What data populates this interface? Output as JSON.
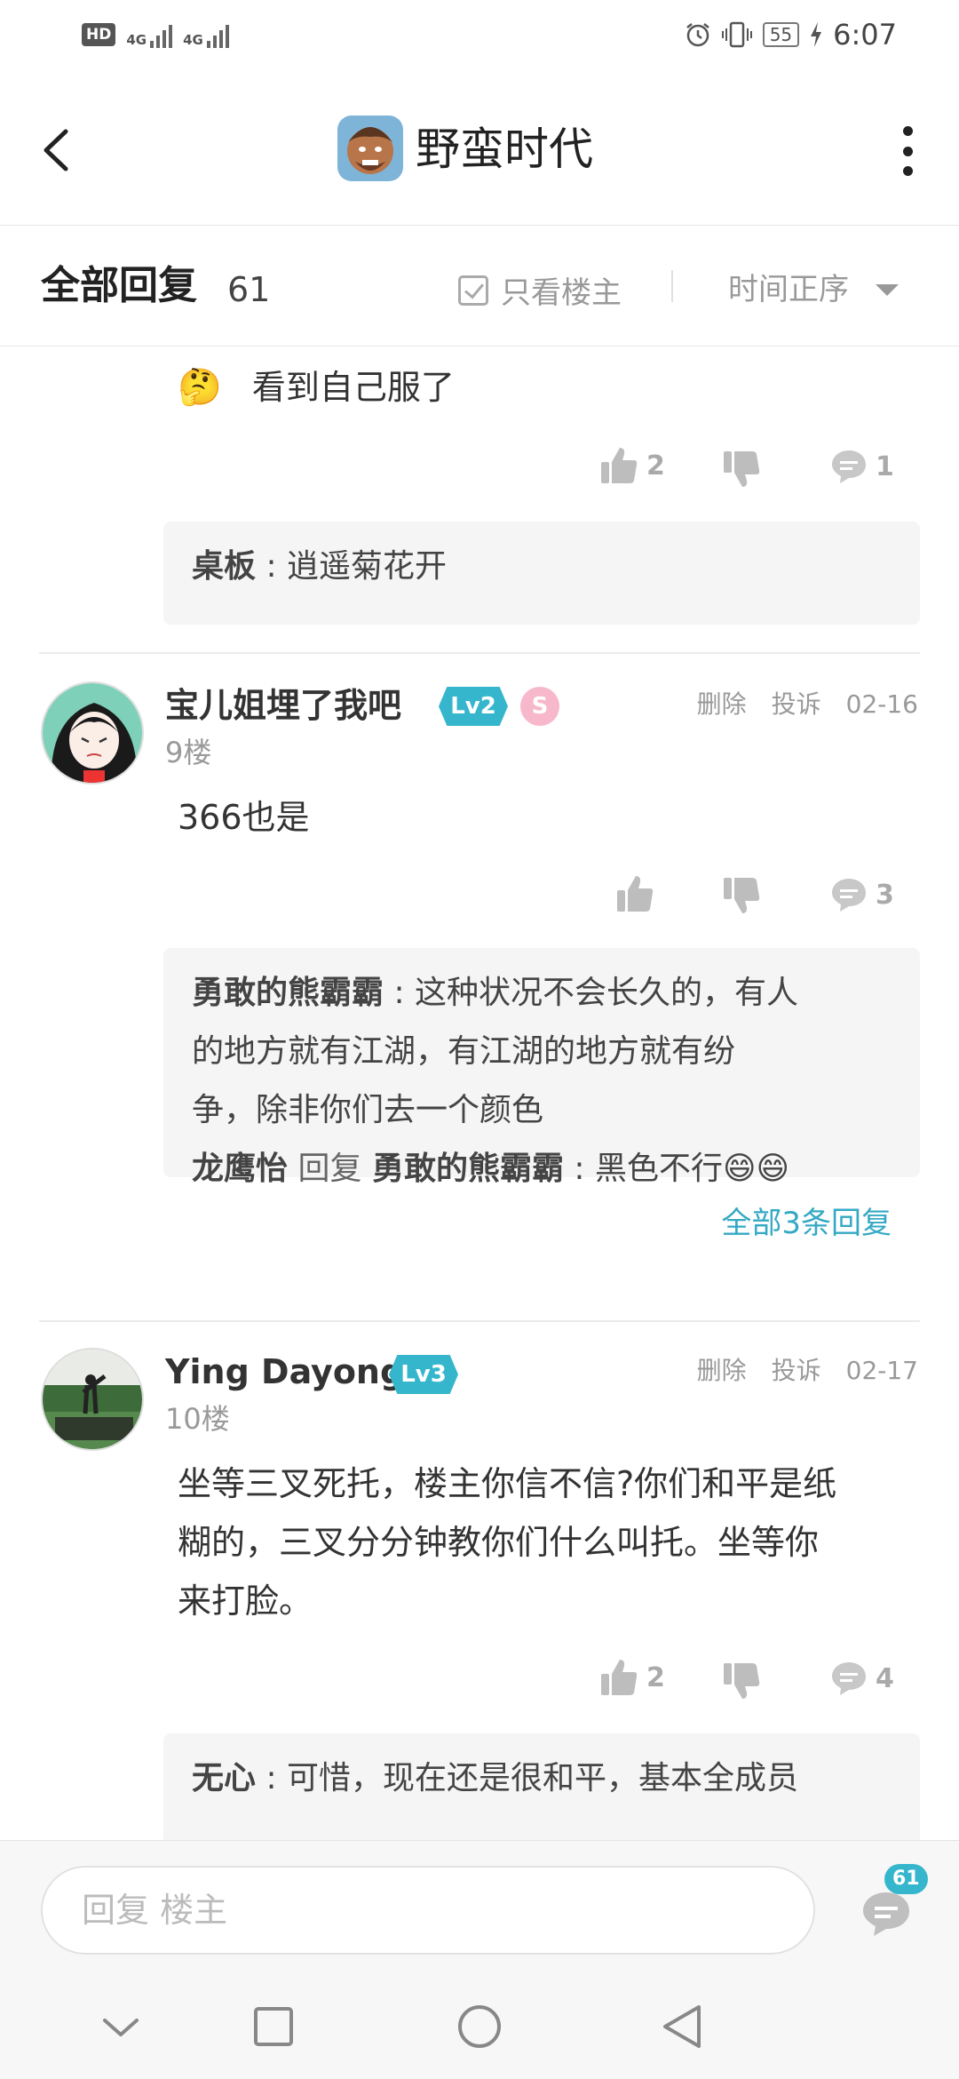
{
  "status_bar": {
    "hd": "HD",
    "sim1": "4G",
    "sim2": "4G",
    "battery": "55",
    "time": "6:07"
  },
  "top_bar": {
    "title": "野蛮时代",
    "back_icon": "chevron-left-icon",
    "more_icon": "more-vertical-icon"
  },
  "reply_header": {
    "title": "全部回复",
    "count": "61",
    "only_op": "只看楼主",
    "sort": "时间正序"
  },
  "posts": [
    {
      "emoji": "🤔",
      "text": "看到自己服了",
      "likes": "2",
      "comments": "1",
      "quotes": [
        {
          "user": "桌板",
          "text": "逍遥菊花开"
        }
      ]
    },
    {
      "username": "宝儿姐埋了我吧",
      "level": "Lv2",
      "medal": "S",
      "floor": "9楼",
      "delete": "删除",
      "report": "投诉",
      "date": "02-16",
      "text": "366也是",
      "comments": "3",
      "quote_lines": [
        {
          "user": "勇敢的熊霸霸",
          "text": "这种状况不会长久的，有人"
        },
        {
          "text": "的地方就有江湖，有江湖的地方就有纷"
        },
        {
          "text": "争，除非你们去一个颜色"
        }
      ],
      "quote_reply": {
        "user": "龙鹰怡",
        "reply_word": "回复",
        "target": "勇敢的熊霸霸",
        "text": "黑色不行😄😄"
      },
      "more_replies": "全部3条回复"
    },
    {
      "username": "Ying Dayong",
      "level": "Lv3",
      "floor": "10楼",
      "delete": "删除",
      "report": "投诉",
      "date": "02-17",
      "text_lines": [
        "坐等三叉死托，楼主你信不信?你们和平是纸",
        "糊的，三叉分分钟教你们什么叫托。坐等你",
        "来打脸。"
      ],
      "likes": "2",
      "comments": "4",
      "quotes": [
        {
          "user": "无心",
          "text": "可惜，现在还是很和平，基本全成员"
        }
      ]
    }
  ],
  "bottom_bar": {
    "placeholder": "回复  楼主",
    "badge_count": "61"
  },
  "colors": {
    "accent": "#35b6cc",
    "link": "#34a9c4"
  }
}
